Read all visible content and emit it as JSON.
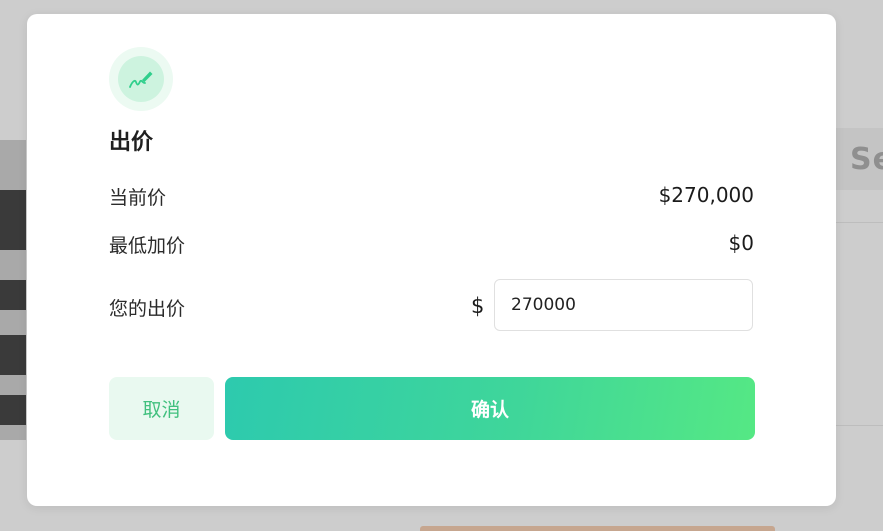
{
  "background": {
    "partial_text": "Se"
  },
  "modal": {
    "icon": "pen-signature-icon",
    "title": "出价",
    "rows": [
      {
        "label": "当前价",
        "value": "$270,000"
      },
      {
        "label": "最低加价",
        "value": "$0"
      }
    ],
    "bid": {
      "label": "您的出价",
      "currency_symbol": "$",
      "input_value": "270000"
    },
    "buttons": {
      "cancel": "取消",
      "confirm": "确认"
    }
  },
  "colors": {
    "accent_green": "#41c07e",
    "confirm_gradient_start": "#2dcaae",
    "confirm_gradient_end": "#55e884",
    "cancel_bg": "#e9f9f0"
  }
}
